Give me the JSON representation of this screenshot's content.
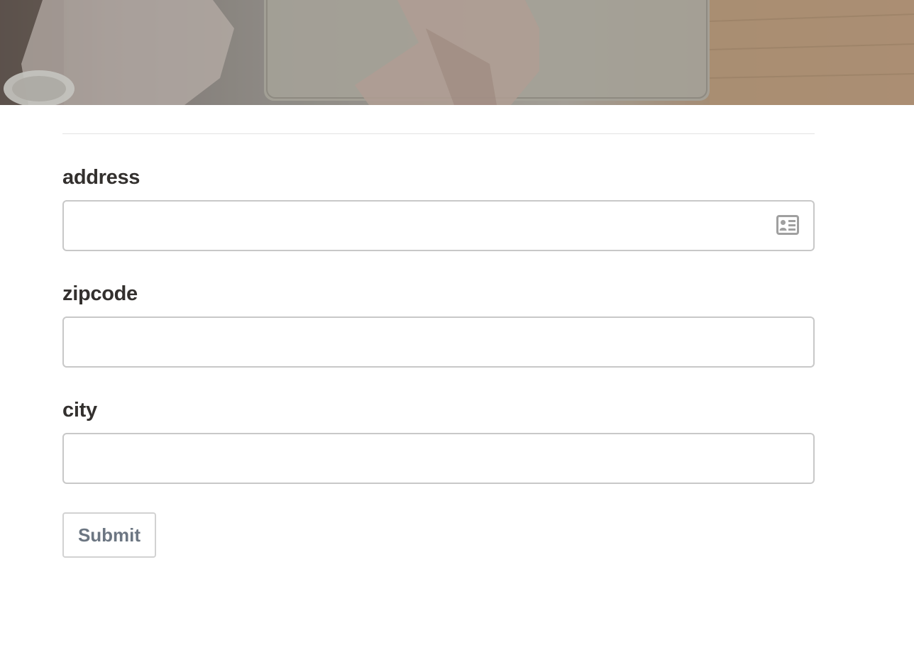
{
  "form": {
    "fields": [
      {
        "label": "address",
        "value": "",
        "placeholder": "",
        "icon": "contact-card-icon"
      },
      {
        "label": "zipcode",
        "value": "",
        "placeholder": ""
      },
      {
        "label": "city",
        "value": "",
        "placeholder": ""
      }
    ],
    "submit_label": "Submit"
  },
  "colors": {
    "label_text": "#33302e",
    "input_border": "#c8c8c8",
    "button_text": "#6c7682",
    "icon": "#a0a0a0"
  }
}
